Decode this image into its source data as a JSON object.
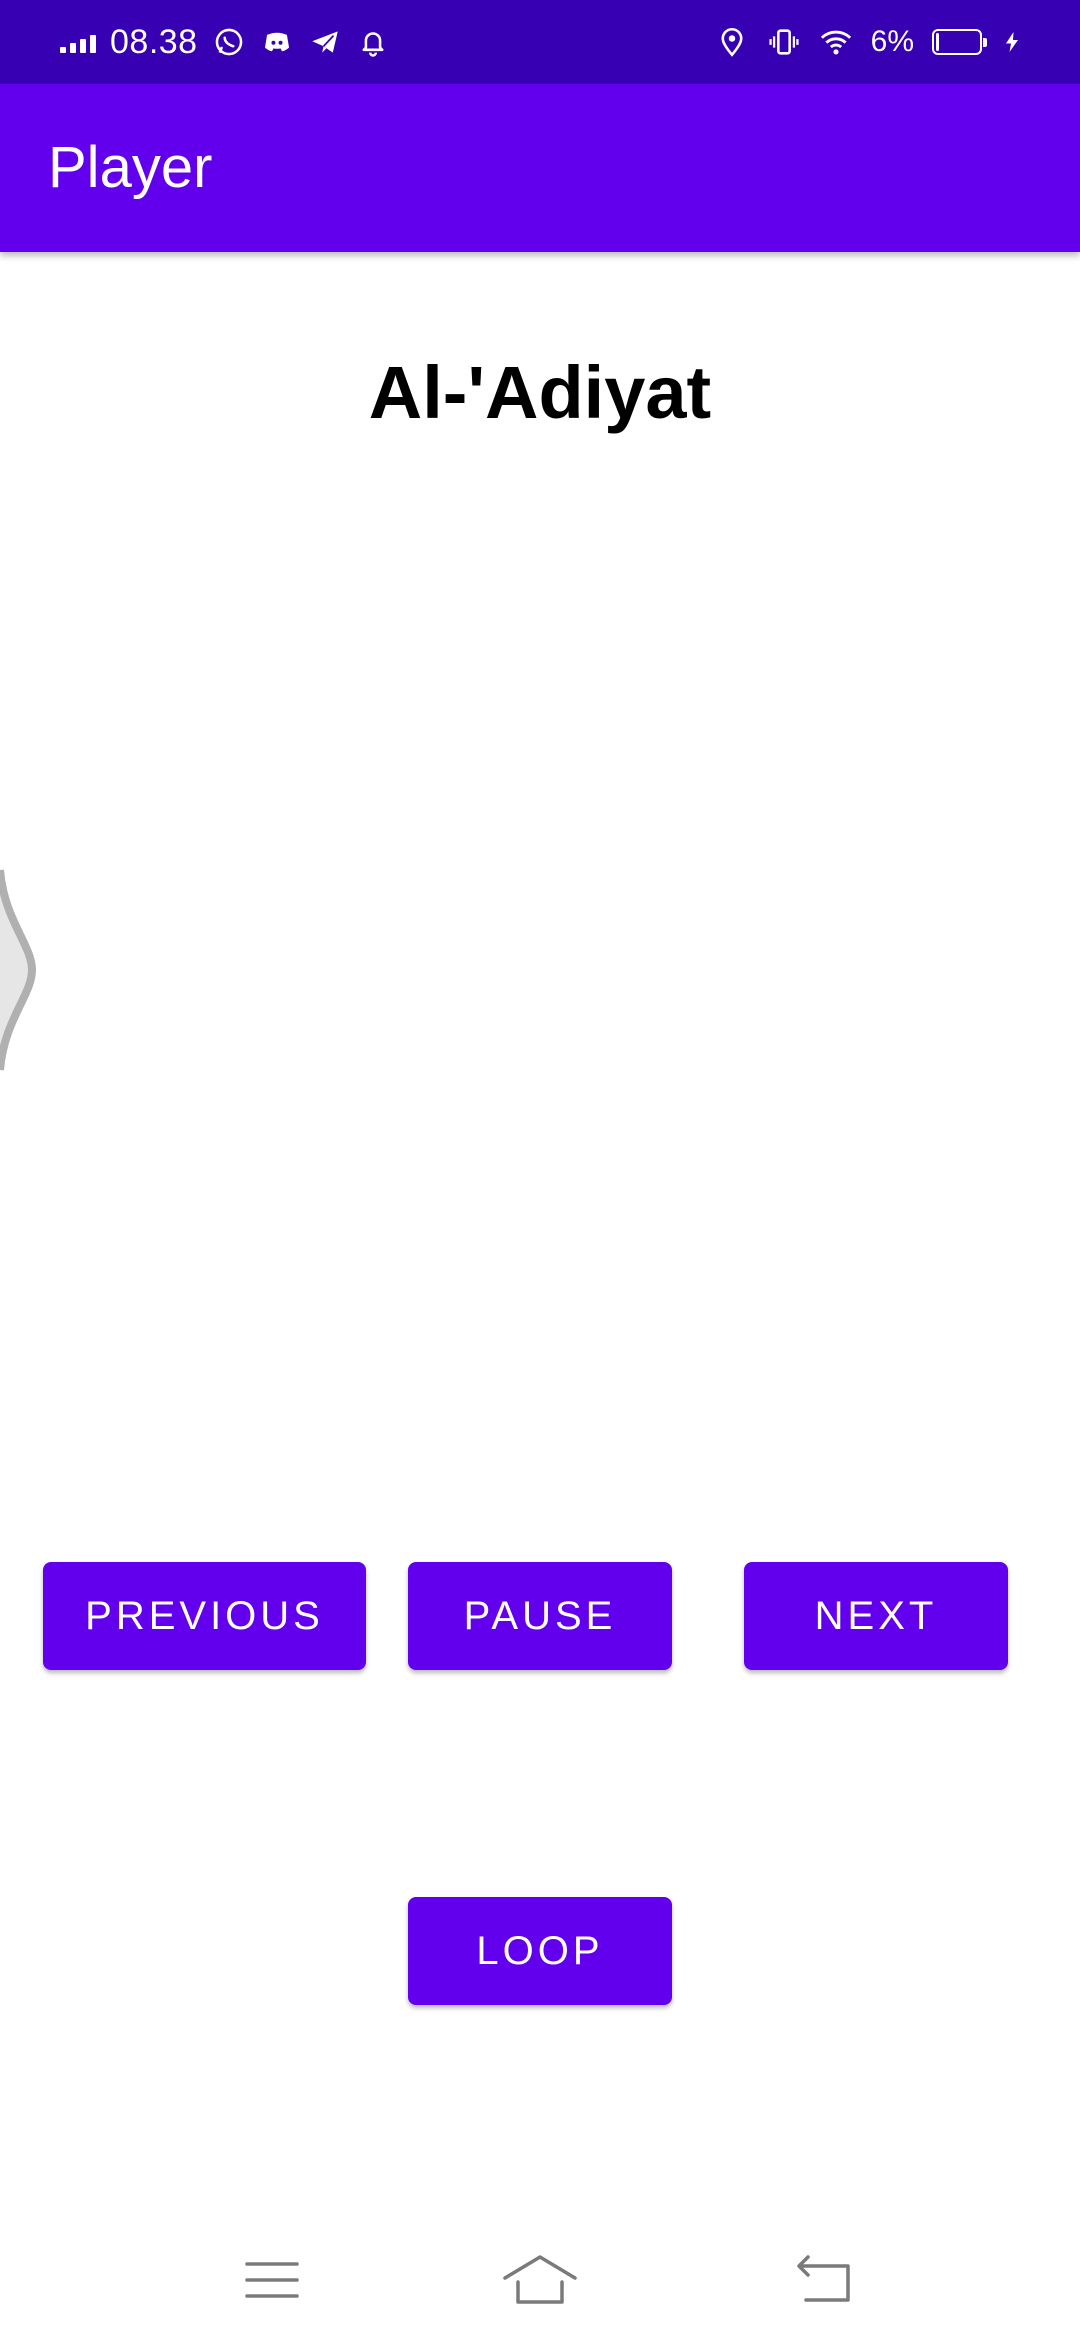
{
  "status_bar": {
    "time": "08.38",
    "battery_percent": "6%",
    "battery_level": 0.06,
    "notification_icons": [
      "whatsapp-icon",
      "discord-icon",
      "telegram-icon",
      "bell-icon"
    ],
    "system_icons": [
      "location-icon",
      "vibrate-icon",
      "wifi-icon",
      "battery-icon",
      "charging-icon"
    ]
  },
  "app_bar": {
    "title": "Player"
  },
  "player": {
    "track_title": "Al-'Adiyat"
  },
  "controls": {
    "previous_label": "PREVIOUS",
    "pause_label": "PAUSE",
    "next_label": "NEXT",
    "loop_label": "LOOP"
  },
  "nav_bar": {
    "icons": [
      "menu-icon",
      "home-icon",
      "back-icon"
    ]
  },
  "colors": {
    "status_bar": "#3700b3",
    "primary": "#6200ee",
    "background": "#ffffff",
    "title_text": "#000000",
    "button_text": "#ffffff"
  }
}
